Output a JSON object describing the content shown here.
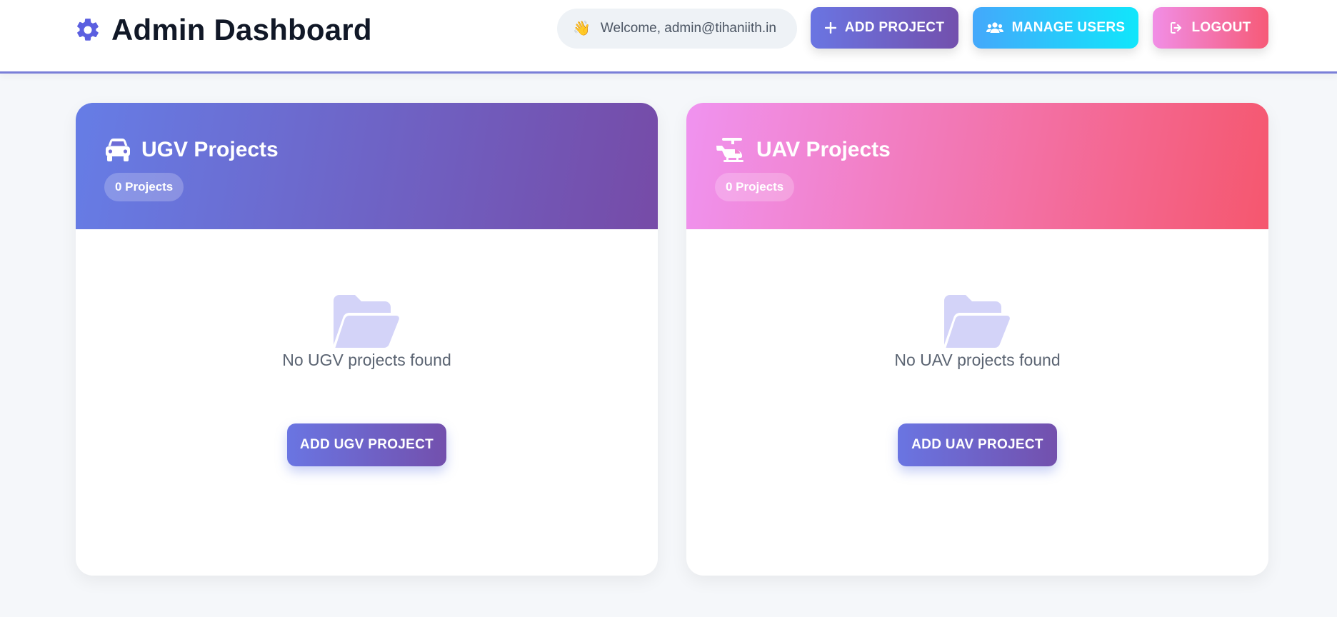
{
  "header": {
    "title": "Admin Dashboard",
    "brand_icon": "gear-icon",
    "welcome_text": "Welcome, admin@tihaniith.in",
    "welcome_emoji": "👋",
    "buttons": {
      "add_project": "ADD PROJECT",
      "manage_users": "MANAGE USERS",
      "logout": "LOGOUT"
    }
  },
  "colors": {
    "accent": "#6a5fe0",
    "ugv_gradient": [
      "#667de6",
      "#764ba7"
    ],
    "uav_gradient": [
      "#f093f0",
      "#f5576e"
    ],
    "users_gradient": [
      "#44a8fb",
      "#10e6fb"
    ]
  },
  "cards": [
    {
      "icon": "car-icon",
      "title": "UGV Projects",
      "count": "0 Projects",
      "empty_message": "No UGV projects found",
      "button": "ADD UGV PROJECT"
    },
    {
      "icon": "helicopter-icon",
      "title": "UAV Projects",
      "count": "0 Projects",
      "empty_message": "No UAV projects found",
      "button": "ADD UAV PROJECT"
    }
  ]
}
